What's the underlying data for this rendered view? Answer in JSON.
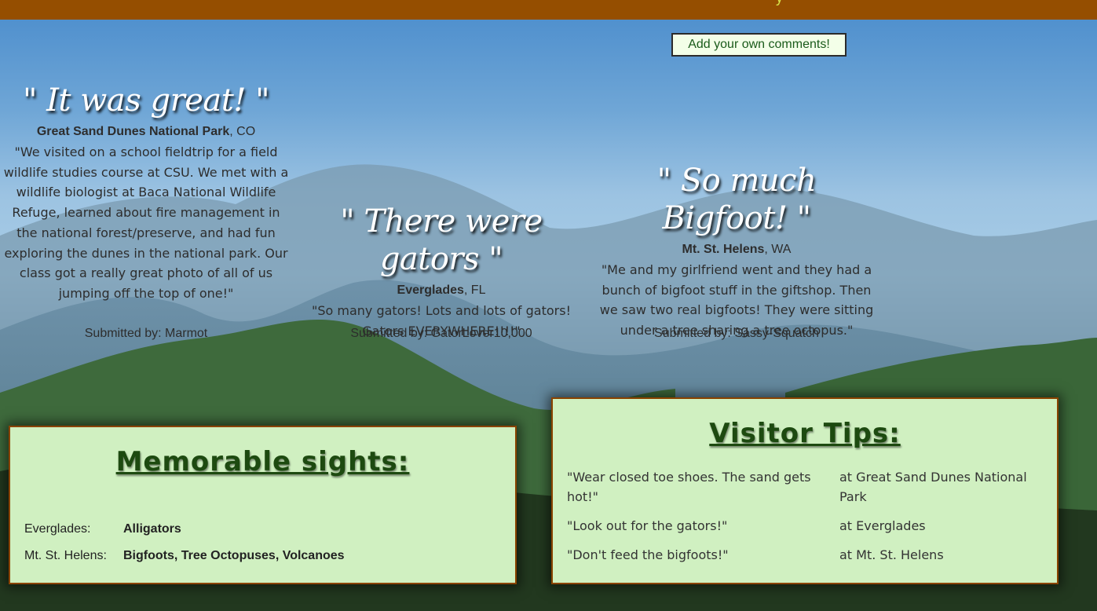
{
  "header": {
    "glyph": "y"
  },
  "add_comment_label": "Add your own comments!",
  "reviews": [
    {
      "headline": "\" It was great! \"",
      "place_name": "Great Sand Dunes National Park",
      "place_state": ", CO",
      "body": "\"We visited on a school fieldtrip for a field wildlife studies course at CSU. We met with a wildlife biologist at Baca National Wildlife Refuge, learned about fire management in the national forest/preserve, and had fun exploring the dunes in the national park. Our class got a really great photo of all of us jumping off the top of one!\"",
      "submitted_by": "Submitted by: Marmot"
    },
    {
      "headline": "\" There were gators \"",
      "place_name": "Everglades",
      "place_state": ", FL",
      "body": "\"So many gators! Lots and lots of gators! Gators EVERYWHERE!!!!\"",
      "submitted_by": "Submitted by: GatorLover10,000"
    },
    {
      "headline": "\" So much Bigfoot! \"",
      "place_name": "Mt. St. Helens",
      "place_state": ", WA",
      "body": "\"Me and my girlfriend went and they had a bunch of bigfoot stuff in the giftshop. Then we saw two real bigfoots! They were sitting under a tree sharing a tree octopus.\"",
      "submitted_by": "Submitted by: Sassy-Squatch"
    }
  ],
  "sights": {
    "title": "Memorable sights:",
    "rows": [
      {
        "label": "Everglades:",
        "value": "Alligators"
      },
      {
        "label": "Mt. St. Helens:",
        "value": "Bigfoots, Tree Octopuses, Volcanoes"
      }
    ]
  },
  "tips": {
    "title": "Visitor Tips:",
    "rows": [
      {
        "quote": "\"Wear closed toe shoes. The sand gets hot!\"",
        "where": "at Great Sand Dunes National Park"
      },
      {
        "quote": "\"Look out for the gators!\"",
        "where": "at Everglades"
      },
      {
        "quote": "\"Don't feed the bigfoots!\"",
        "where": "at Mt. St. Helens"
      }
    ]
  },
  "colors": {
    "header_bg": "#954e00",
    "panel_bg": "#d0f0c1",
    "panel_border": "#8a4300",
    "panel_title": "#1d4a10"
  }
}
